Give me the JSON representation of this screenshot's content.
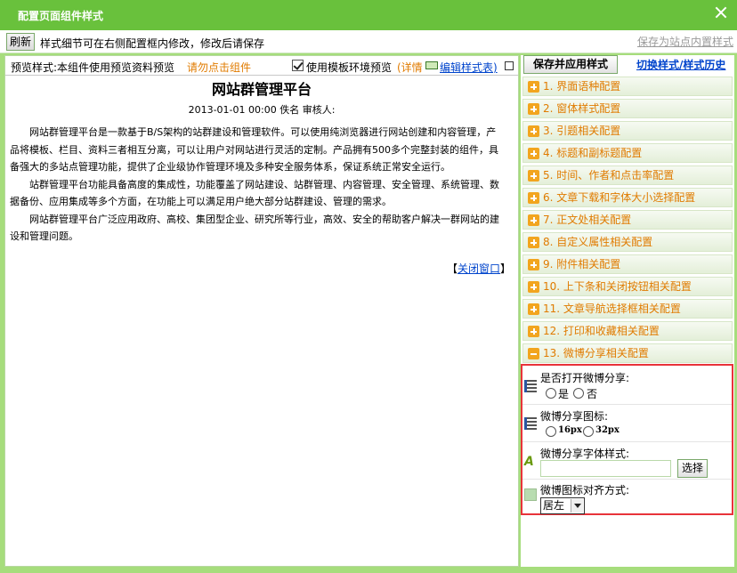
{
  "window": {
    "title": "配置页面组件样式"
  },
  "toolbar": {
    "refresh_label": "刷新",
    "hint": "样式细节可在右侧配置框内修改，修改后请保存",
    "save_internal": "保存为站点内置样式"
  },
  "preview": {
    "label": "预览样式:本组件使用预览资料预览",
    "warn": "请勿点击组件",
    "use_template_label": "使用模板环境预览",
    "use_template_checked": true,
    "detail": "(详情",
    "edit_style_link": "编辑样式表)"
  },
  "article": {
    "title": "网站群管理平台",
    "meta": "2013-01-01 00:00  佚名  审核人:",
    "paragraphs": [
      "网站群管理平台是一款基于B/S架构的站群建设和管理软件。可以使用纯浏览器进行网站创建和内容管理，产品将模板、栏目、资料三者相互分离，可以让用户对网站进行灵活的定制。产品拥有500多个完整封装的组件，具备强大的多站点管理功能，提供了企业级协作管理环境及多种安全服务体系，保证系统正常安全运行。",
      "站群管理平台功能具备高度的集成性，功能覆盖了网站建设、站群管理、内容管理、安全管理、系统管理、数据备份、应用集成等多个方面，在功能上可以满足用户绝大部分站群建设、管理的需求。",
      "网站群管理平台广泛应用政府、高校、集团型企业、研究所等行业，高效、安全的帮助客户解决一群网站的建设和管理问题。"
    ],
    "close_open": "【",
    "close_link": "关闭窗口",
    "close_end": "】"
  },
  "right": {
    "save_apply": "保存并应用样式",
    "switch_history": "切换样式/样式历史",
    "sections": [
      {
        "label": "1.  界面语种配置",
        "expanded": false
      },
      {
        "label": "2.  窗体样式配置",
        "expanded": false
      },
      {
        "label": "3.  引题相关配置",
        "expanded": false
      },
      {
        "label": "4.  标题和副标题配置",
        "expanded": false
      },
      {
        "label": "5.  时间、作者和点击率配置",
        "expanded": false
      },
      {
        "label": "6.  文章下载和字体大小选择配置",
        "expanded": false
      },
      {
        "label": "7.  正文处相关配置",
        "expanded": false
      },
      {
        "label": "8.  自定义属性相关配置",
        "expanded": false
      },
      {
        "label": "9.  附件相关配置",
        "expanded": false
      },
      {
        "label": "10.  上下条和关闭按钮相关配置",
        "expanded": false
      },
      {
        "label": "11.  文章导航选择框相关配置",
        "expanded": false
      },
      {
        "label": "12.  打印和收藏相关配置",
        "expanded": false
      },
      {
        "label": "13.  微博分享相关配置",
        "expanded": true
      }
    ]
  },
  "weibo": {
    "enable_label": "是否打开微博分享:",
    "yes": "是",
    "no": "否",
    "icon_label": "微博分享图标:",
    "icon_16": "16px",
    "icon_32": "32px",
    "font_label": "微博分享字体样式:",
    "font_value": "",
    "choose_label": "选择",
    "align_label": "微博图标对齐方式:",
    "align_value": "居左"
  }
}
